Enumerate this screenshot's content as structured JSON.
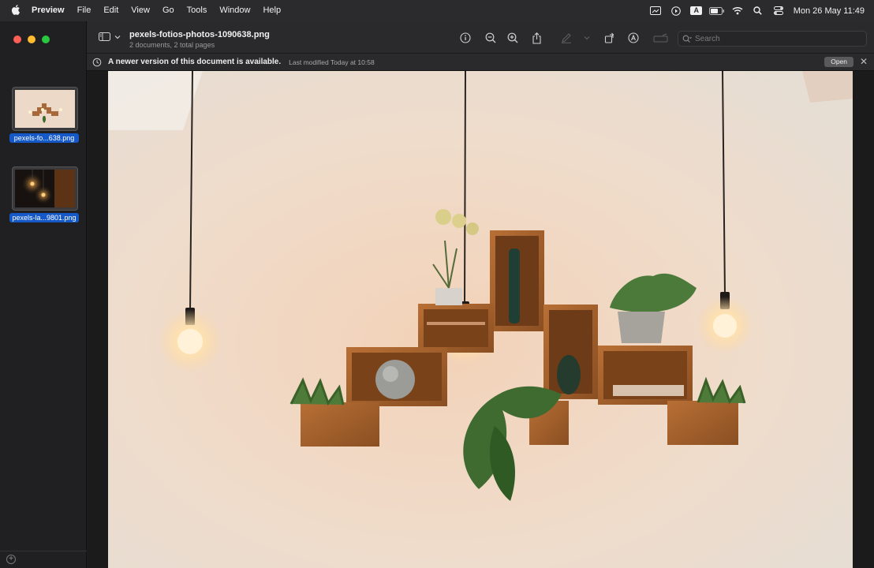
{
  "menubar": {
    "app_name": "Preview",
    "menus": [
      "File",
      "Edit",
      "View",
      "Go",
      "Tools",
      "Window",
      "Help"
    ],
    "input_source": "A",
    "clock": "Mon 26 May  11:49"
  },
  "sidebar": {
    "thumbnails": [
      {
        "label": "pexels-fo...638.png",
        "selected": true
      },
      {
        "label": "pexels-la...9801.png",
        "selected": true
      }
    ]
  },
  "toolbar": {
    "title": "pexels-fotios-photos-1090638.png",
    "subtitle": "2 documents, 2 total pages",
    "search_placeholder": "Search"
  },
  "banner": {
    "message": "A newer version of this document is available.",
    "modified": "Last modified Today at 10:58",
    "open_label": "Open"
  },
  "colors": {
    "accent": "#1459c7",
    "close": "#ff5f57",
    "minimize": "#febc2e",
    "zoom": "#28c840"
  }
}
